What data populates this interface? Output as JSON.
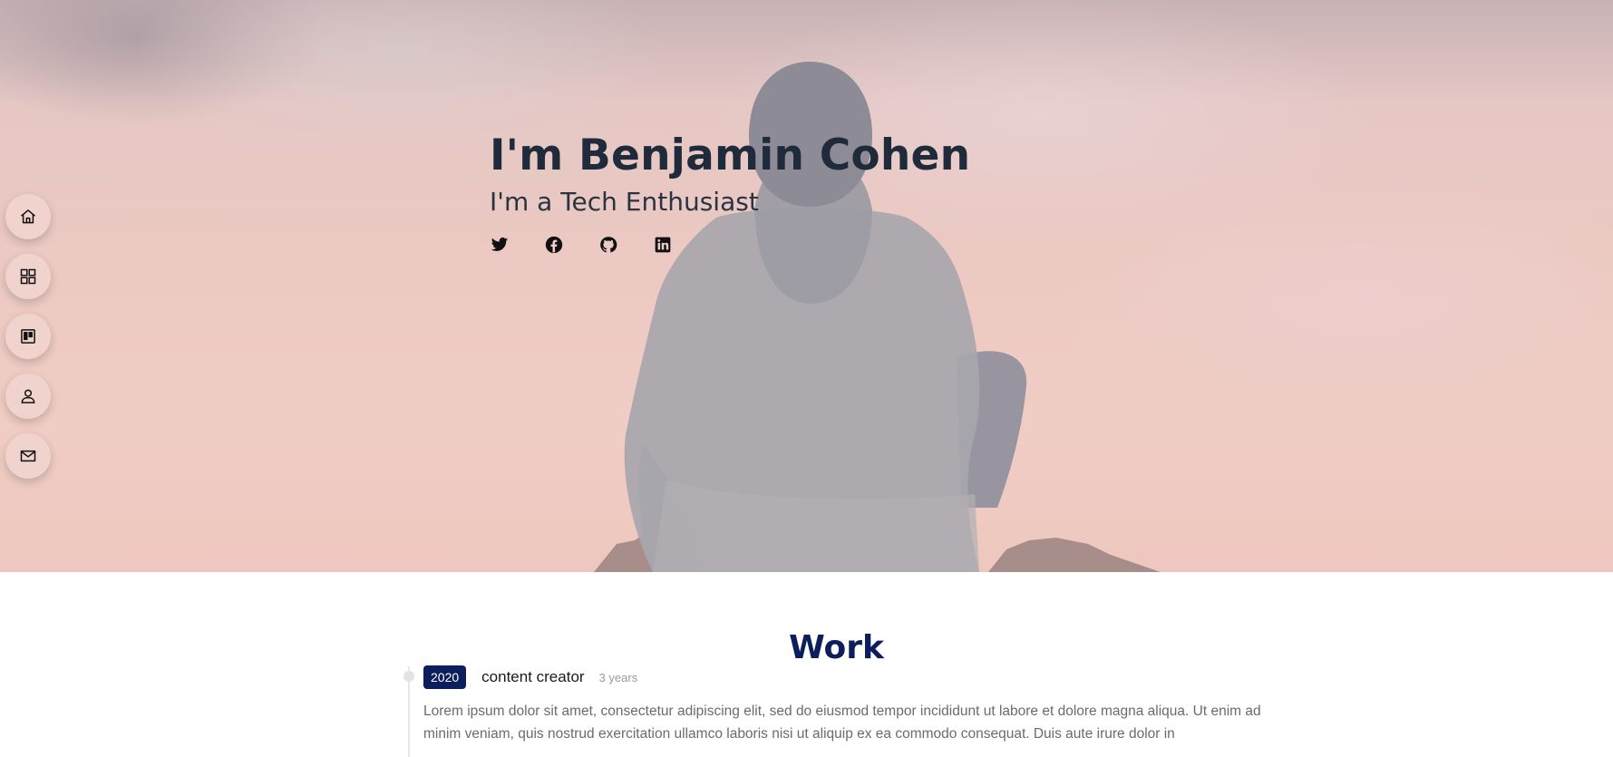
{
  "hero": {
    "title": "I'm Benjamin Cohen",
    "subtitle": "I'm a Tech Enthusiast",
    "socials": [
      {
        "name": "twitter-icon"
      },
      {
        "name": "facebook-icon"
      },
      {
        "name": "github-icon"
      },
      {
        "name": "linkedin-icon"
      }
    ]
  },
  "sidenav": {
    "items": [
      {
        "icon": "home-icon"
      },
      {
        "icon": "grid-icon"
      },
      {
        "icon": "board-icon"
      },
      {
        "icon": "user-icon"
      },
      {
        "icon": "mail-icon"
      }
    ]
  },
  "work": {
    "title": "Work",
    "entries": [
      {
        "year": "2020",
        "role": "content creator",
        "duration": "3 years",
        "description": "Lorem ipsum dolor sit amet, consectetur adipiscing elit, sed do eiusmod tempor incididunt ut labore et dolore magna aliqua. Ut enim ad minim veniam, quis nostrud exercitation ullamco laboris nisi ut aliquip ex ea commodo consequat. Duis aute irure dolor in"
      }
    ]
  },
  "colors": {
    "accent": "#0c1f5c",
    "hero_text": "#1f2a3a",
    "nav_button": "#f1d3cd"
  }
}
